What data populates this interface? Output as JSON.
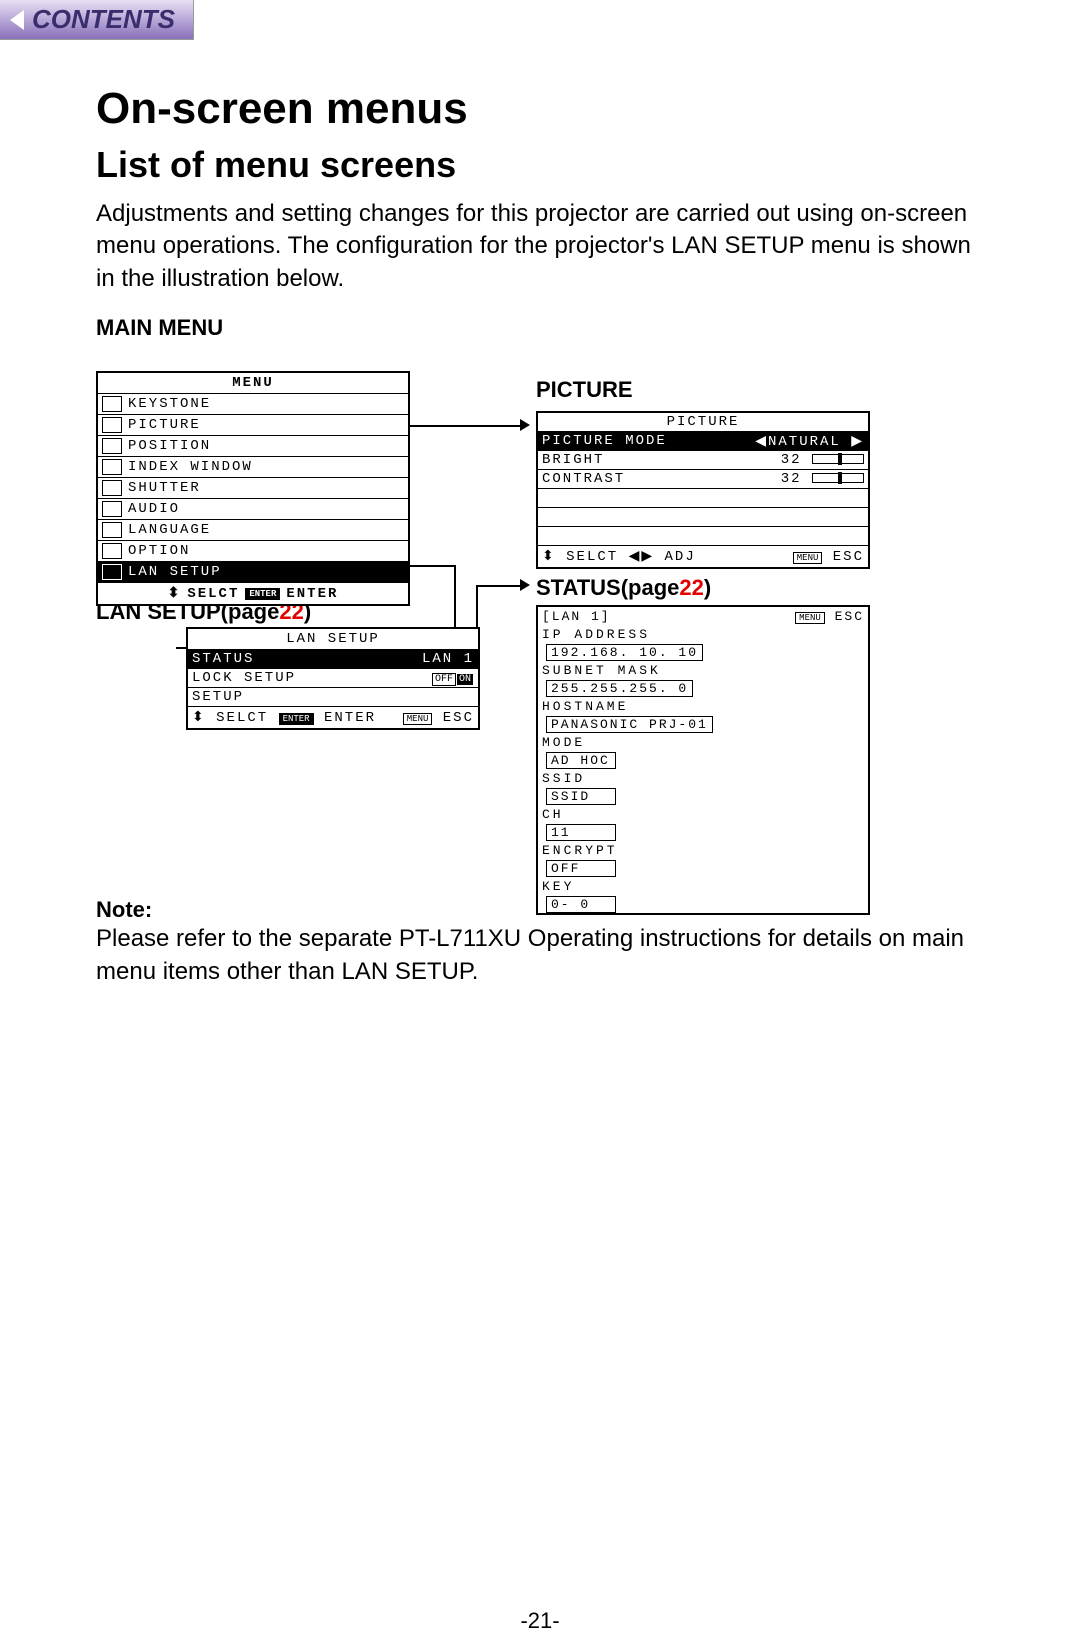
{
  "contents_label": "CONTENTS",
  "h1": "On-screen menus",
  "h2": "List of menu screens",
  "intro": "Adjustments and setting changes for this projector are carried out using on-screen menu operations. The configuration for the projector's LAN SETUP menu is shown in the illustration below.",
  "labels": {
    "main_menu": "MAIN MENU",
    "picture": "PICTURE",
    "lan_setup_pre": "LAN SETUP(page",
    "lan_setup_pg": "22",
    "lan_setup_post": ")",
    "status_pre": "STATUS(page",
    "status_pg": "22",
    "status_post": ")"
  },
  "main_menu": {
    "title": "MENU",
    "items": [
      "KEYSTONE",
      "PICTURE",
      "POSITION",
      "INDEX WINDOW",
      "SHUTTER",
      "AUDIO",
      "LANGUAGE",
      "OPTION",
      "LAN SETUP"
    ],
    "selected_index": 8,
    "footer_selct": "SELCT",
    "footer_enter_badge": "ENTER",
    "footer_enter": "ENTER",
    "updown": "⬍"
  },
  "lan_setup_menu": {
    "title": "LAN SETUP",
    "rows": [
      {
        "label": "STATUS",
        "value": "LAN 1"
      },
      {
        "label": "LOCK SETUP",
        "value_off": "OFF",
        "value_on": "ON"
      },
      {
        "label": "SETUP",
        "value": ""
      }
    ],
    "selected_index": 0,
    "footer_selct": "SELCT",
    "footer_enter_badge": "ENTER",
    "footer_enter": "ENTER",
    "footer_menu_badge": "MENU",
    "footer_esc": "ESC",
    "updown": "⬍"
  },
  "picture_menu": {
    "title": "PICTURE",
    "mode_row": {
      "label": "PICTURE MODE",
      "value": "NATURAL",
      "left": "◀",
      "right": "▶"
    },
    "rows": [
      {
        "label": "BRIGHT",
        "value": "32"
      },
      {
        "label": "CONTRAST",
        "value": "32"
      }
    ],
    "footer_selct": "SELCT",
    "footer_adj": "ADJ",
    "footer_menu_badge": "MENU",
    "footer_esc": "ESC",
    "updown": "⬍",
    "leftright": "◀▶"
  },
  "status_menu": {
    "header_left": "[LAN 1]",
    "header_menu_badge": "MENU",
    "header_esc": "ESC",
    "lines": [
      {
        "label": "IP ADDRESS",
        "box": "192.168. 10. 10"
      },
      {
        "label": "SUBNET MASK",
        "box": "255.255.255.  0"
      },
      {
        "label": "HOSTNAME",
        "box": "PANASONIC PRJ-01"
      },
      {
        "label": "MODE",
        "box": "AD HOC"
      },
      {
        "label": "SSID",
        "box": "SSID"
      },
      {
        "label": "CH",
        "box": "11"
      },
      {
        "label": "ENCRYPT",
        "box": "OFF"
      },
      {
        "label": "KEY",
        "box": "0- 0"
      }
    ]
  },
  "note_heading": "Note:",
  "note_body": "Please refer to the separate PT-L711XU Operating instructions for details on main menu items other than LAN SETUP.",
  "page_number": "-21-"
}
